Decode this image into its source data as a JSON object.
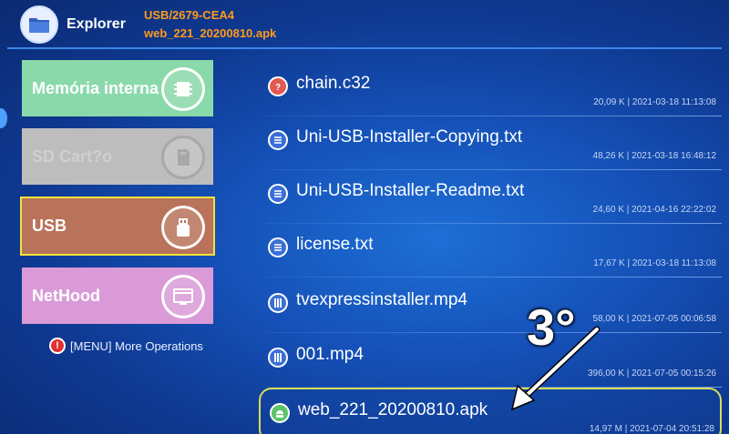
{
  "header": {
    "app_title": "Explorer",
    "path_line1": "USB/2679-CEA4",
    "path_line2": "web_221_20200810.apk"
  },
  "nav": {
    "memory": {
      "label": "Memória interna"
    },
    "sd": {
      "label": "SD Cart?o"
    },
    "usb": {
      "label": "USB"
    },
    "nethood": {
      "label": "NetHood"
    },
    "menu_hint": "[MENU] More Operations"
  },
  "files": [
    {
      "name": "chain.c32",
      "meta": "20,09 K | 2021-03-18 11:13:08",
      "icon": "unknown-file-icon",
      "icon_color": "#e05a4f"
    },
    {
      "name": "Uni-USB-Installer-Copying.txt",
      "meta": "48,26 K | 2021-03-18 16:48:12",
      "icon": "text-file-icon",
      "icon_color": "#3b6fd8"
    },
    {
      "name": "Uni-USB-Installer-Readme.txt",
      "meta": "24,60 K | 2021-04-16 22:22:02",
      "icon": "text-file-icon",
      "icon_color": "#3b6fd8"
    },
    {
      "name": "license.txt",
      "meta": "17,67 K | 2021-03-18 11:13:08",
      "icon": "text-file-icon",
      "icon_color": "#3b6fd8"
    },
    {
      "name": "tvexpressinstaller.mp4",
      "meta": "58,00 K | 2021-07-05 00:06:58",
      "icon": "video-file-icon",
      "icon_color": "#3b6fd8"
    },
    {
      "name": "001.mp4",
      "meta": "396,00 K | 2021-07-05 00:15:26",
      "icon": "video-file-icon",
      "icon_color": "#3b6fd8"
    },
    {
      "name": "web_221_20200810.apk",
      "meta": "14,97 M | 2021-07-04 20:51:28",
      "icon": "apk-file-icon",
      "icon_color": "#5cc46b"
    }
  ],
  "annotation": {
    "label": "3°"
  },
  "colors": {
    "accent_orange": "#ff9a1a",
    "selection_border": "#d8dd5a"
  }
}
